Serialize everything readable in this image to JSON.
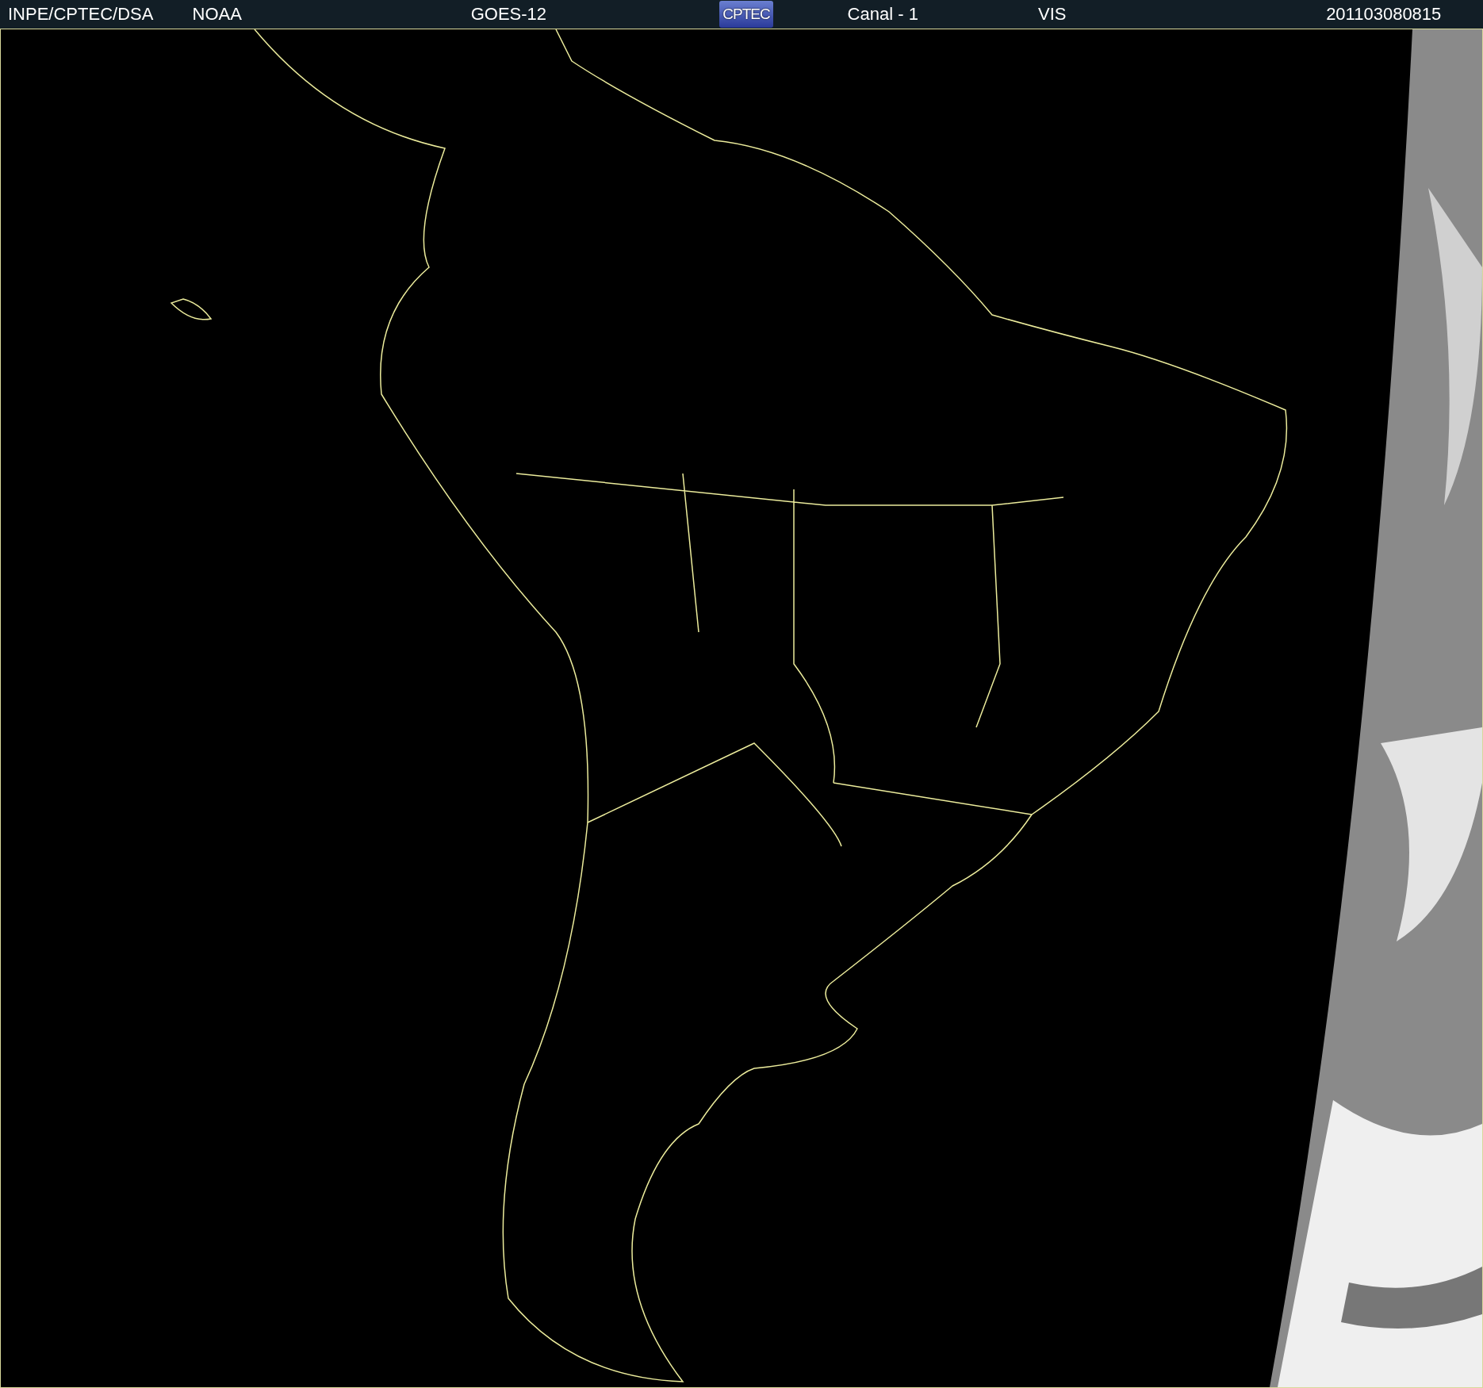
{
  "header": {
    "source": "INPE/CPTEC/DSA",
    "agency": "NOAA",
    "satellite": "GOES-12",
    "logo": "CPTEC",
    "channel": "Canal - 1",
    "band": "VIS",
    "timestamp": "201103080815"
  }
}
